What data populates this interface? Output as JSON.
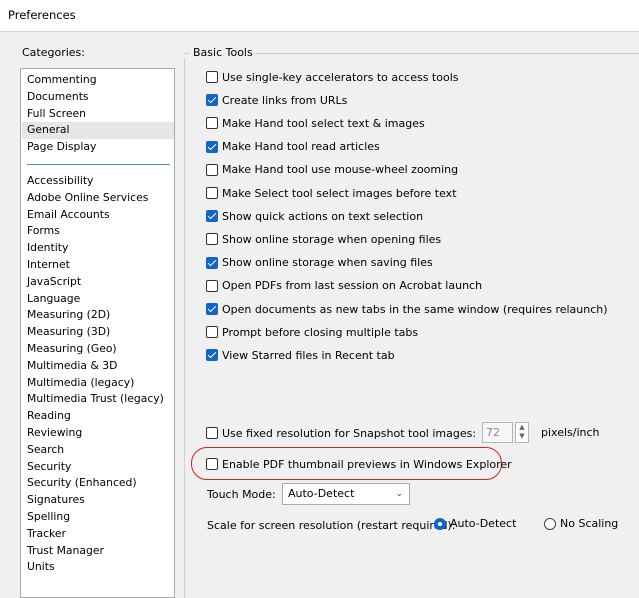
{
  "window": {
    "title": "Preferences"
  },
  "categories": {
    "label": "Categories:",
    "selected": "General",
    "items": [
      "Commenting",
      "Documents",
      "Full Screen",
      "General",
      "Page Display",
      "Accessibility",
      "Adobe Online Services",
      "Email Accounts",
      "Forms",
      "Identity",
      "Internet",
      "JavaScript",
      "Language",
      "Measuring (2D)",
      "Measuring (3D)",
      "Measuring (Geo)",
      "Multimedia & 3D",
      "Multimedia (legacy)",
      "Multimedia Trust (legacy)",
      "Reading",
      "Reviewing",
      "Search",
      "Security",
      "Security (Enhanced)",
      "Signatures",
      "Spelling",
      "Tracker",
      "Trust Manager",
      "Units"
    ]
  },
  "basic_tools": {
    "label": "Basic Tools",
    "options": [
      {
        "label": "Use single-key accelerators to access tools",
        "checked": false
      },
      {
        "label": "Create links from URLs",
        "checked": true
      },
      {
        "label": "Make Hand tool select text & images",
        "checked": false
      },
      {
        "label": "Make Hand tool read articles",
        "checked": true
      },
      {
        "label": "Make Hand tool use mouse-wheel zooming",
        "checked": false
      },
      {
        "label": "Make Select tool select images before text",
        "checked": false
      },
      {
        "label": "Show quick actions on text selection",
        "checked": true
      },
      {
        "label": "Show online storage when opening files",
        "checked": false
      },
      {
        "label": "Show online storage when saving files",
        "checked": true
      },
      {
        "label": "Open PDFs from last session on Acrobat launch",
        "checked": false
      },
      {
        "label": "Open documents as new tabs in the same window (requires relaunch)",
        "checked": true
      },
      {
        "label": "Prompt before closing multiple tabs",
        "checked": false
      },
      {
        "label": "View Starred files in Recent tab",
        "checked": true
      }
    ]
  },
  "snapshot": {
    "label": "Use fixed resolution for Snapshot tool images:",
    "checked": false,
    "value": "72",
    "units": "pixels/inch"
  },
  "thumbnail": {
    "label": "Enable PDF thumbnail previews in Windows Explorer",
    "checked": false
  },
  "touch_mode": {
    "label": "Touch Mode:",
    "value": "Auto-Detect"
  },
  "scale": {
    "label": "Scale for screen resolution (restart required):",
    "options": [
      {
        "label": "Auto-Detect",
        "selected": true
      },
      {
        "label": "No Scaling",
        "selected": false
      }
    ]
  },
  "colors": {
    "accent": "#0f66c8",
    "highlight": "#d32020",
    "selection": "#e6e6e6"
  }
}
